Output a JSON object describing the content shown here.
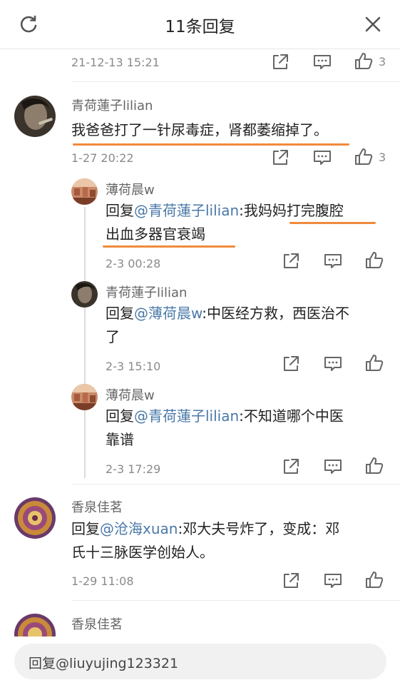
{
  "header": {
    "title": "11条回复"
  },
  "comments": [
    {
      "timestamp": "21-12-13 15:21",
      "likes": "3"
    },
    {
      "author": "青荷蓮子lilian",
      "content": "我爸爸打了一针尿毒症，肾都萎缩掉了。",
      "timestamp": "1-27 20:22",
      "likes": "3",
      "replies": [
        {
          "author": "薄荷晨w",
          "prefix": "回复",
          "mention": "@青荷蓮子lilian",
          "text_line1": ":我妈妈打完腹腔",
          "text_line2": "出血多器官衰竭",
          "timestamp": "2-3 00:28"
        },
        {
          "author": "青荷蓮子lilian",
          "prefix": "回复",
          "mention": "@薄荷晨w",
          "text_line1": ":中医经方救，西医治不",
          "text_line2": "了",
          "timestamp": "2-3 15:10"
        },
        {
          "author": "薄荷晨w",
          "prefix": "回复",
          "mention": "@青荷蓮子lilian",
          "text_line1": ":不知道哪个中医",
          "text_line2": "靠谱",
          "timestamp": "2-3 17:29"
        }
      ]
    },
    {
      "author": "香泉佳茗",
      "prefix": "回复",
      "mention": "@沧海xuan",
      "text_line1": ":邓大夫号炸了，变成：邓",
      "text_line2": "氏十三脉医学创始人。",
      "timestamp": "1-29 11:08"
    },
    {
      "author": "香泉佳茗"
    }
  ],
  "reply_input": {
    "placeholder": "回复@liuyujing123321"
  },
  "colors": {
    "mention": "#4a79a8",
    "highlight_underline": "#f08a3c"
  },
  "icons": [
    "refresh-icon",
    "close-icon",
    "share-icon",
    "comment-icon",
    "like-icon"
  ]
}
